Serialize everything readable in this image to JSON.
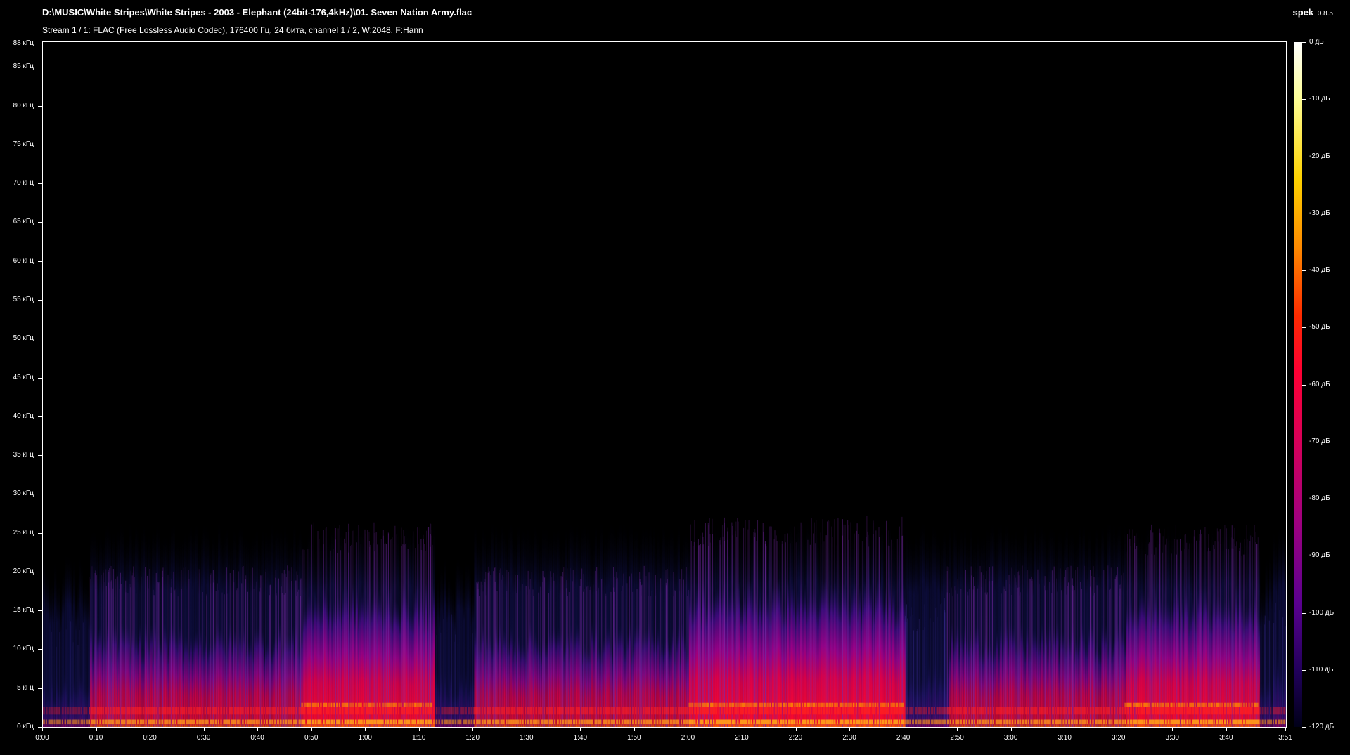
{
  "window": {
    "file_path": "D:\\MUSIC\\White Stripes\\White Stripes - 2003 - Elephant (24bit-176,4kHz)\\01. Seven Nation Army.flac",
    "stream_info": "Stream 1 / 1: FLAC (Free Lossless Audio Codec), 176400 Гц, 24 бита, channel 1 / 2, W:2048, F:Hann",
    "app_name": "spek",
    "app_version": "0.8.5"
  },
  "frequency_axis": {
    "unit": "кГц",
    "labels": [
      "88 кГц",
      "85 кГц",
      "80 кГц",
      "75 кГц",
      "70 кГц",
      "65 кГц",
      "60 кГц",
      "55 кГц",
      "50 кГц",
      "45 кГц",
      "40 кГц",
      "35 кГц",
      "30 кГц",
      "25 кГц",
      "20 кГц",
      "15 кГц",
      "10 кГц",
      "5 кГц",
      "0 кГц"
    ],
    "values_khz": [
      88,
      85,
      80,
      75,
      70,
      65,
      60,
      55,
      50,
      45,
      40,
      35,
      30,
      25,
      20,
      15,
      10,
      5,
      0
    ],
    "max_khz": 88.2
  },
  "time_axis": {
    "labels": [
      "0:00",
      "0:10",
      "0:20",
      "0:30",
      "0:40",
      "0:50",
      "1:00",
      "1:10",
      "1:20",
      "1:30",
      "1:40",
      "1:50",
      "2:00",
      "2:10",
      "2:20",
      "2:30",
      "2:40",
      "2:50",
      "3:00",
      "3:10",
      "3:20",
      "3:30",
      "3:40",
      "3:51"
    ],
    "values_s": [
      0,
      10,
      20,
      30,
      40,
      50,
      60,
      70,
      80,
      90,
      100,
      110,
      120,
      130,
      140,
      150,
      160,
      170,
      180,
      190,
      200,
      210,
      220,
      231
    ],
    "duration_s": 231
  },
  "color_scale": {
    "labels": [
      "0 дБ",
      "-10 дБ",
      "-20 дБ",
      "-30 дБ",
      "-40 дБ",
      "-50 дБ",
      "-60 дБ",
      "-70 дБ",
      "-80 дБ",
      "-90 дБ",
      "-100 дБ",
      "-110 дБ",
      "-120 дБ"
    ],
    "values_db": [
      0,
      -10,
      -20,
      -30,
      -40,
      -50,
      -60,
      -70,
      -80,
      -90,
      -100,
      -110,
      -120
    ],
    "min_db": -120,
    "max_db": 0
  },
  "colors": {
    "background": "#000000",
    "text": "#ffffff",
    "low_energy": "#1a0a5e",
    "mid_energy": "#8a0090",
    "high_energy": "#ff0030",
    "peak_energy": "#ffb000"
  }
}
